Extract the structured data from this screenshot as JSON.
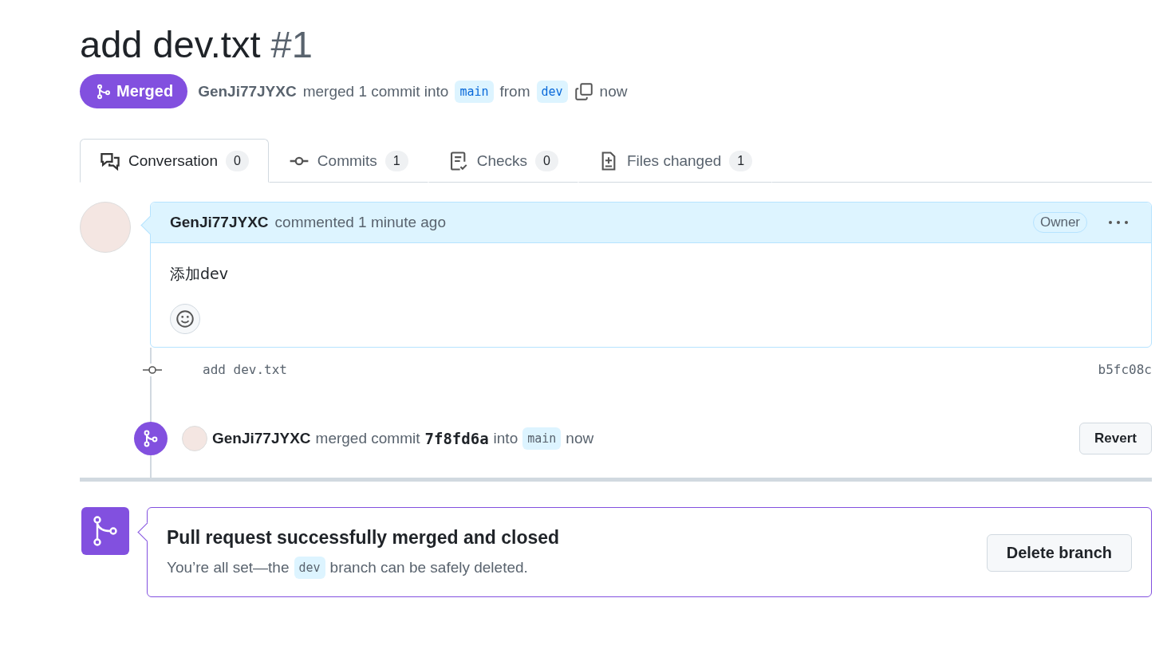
{
  "title": {
    "text": "add dev.txt",
    "number": "#1"
  },
  "state": {
    "label": "Merged",
    "kind": "merged"
  },
  "summary": {
    "author": "GenJi77JYXC",
    "action": "merged 1 commit into",
    "base": "main",
    "from": "from",
    "head": "dev",
    "time": "now"
  },
  "tabs": [
    {
      "kind": "conversation",
      "label": "Conversation",
      "count": "0",
      "selected": true
    },
    {
      "kind": "commits",
      "label": "Commits",
      "count": "1",
      "selected": false
    },
    {
      "kind": "checks",
      "label": "Checks",
      "count": "0",
      "selected": false
    },
    {
      "kind": "files",
      "label": "Files changed",
      "count": "1",
      "selected": false
    }
  ],
  "comment": {
    "author": "GenJi77JYXC",
    "action": "commented 1 minute ago",
    "role": "Owner",
    "body": "添加dev"
  },
  "commits": [
    {
      "message": "add dev.txt",
      "sha": "b5fc08c"
    }
  ],
  "merge_event": {
    "author": "GenJi77JYXC",
    "action": "merged commit",
    "sha": "7f8fd6a",
    "into": "into",
    "branch": "main",
    "time": "now",
    "button": "Revert"
  },
  "merged_box": {
    "title": "Pull request successfully merged and closed",
    "before": "You’re all set—the",
    "branch": "dev",
    "after": "branch can be safely deleted.",
    "button": "Delete branch"
  }
}
